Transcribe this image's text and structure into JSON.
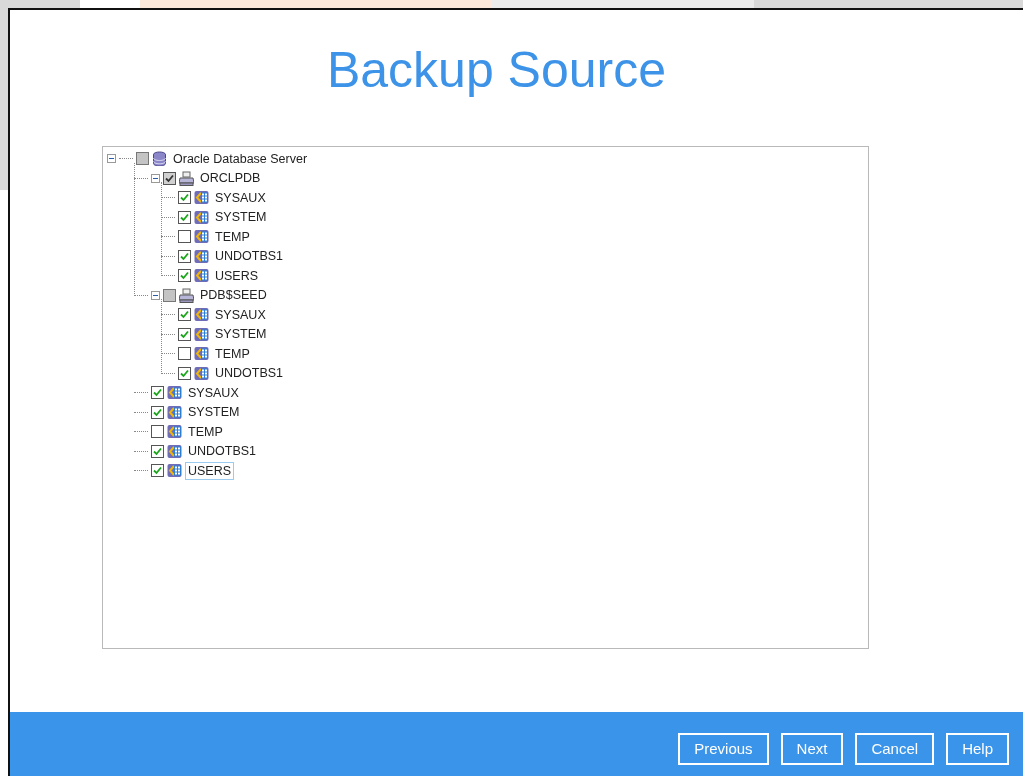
{
  "title": "Backup Source",
  "tree": [
    {
      "label": "Oracle Database Server",
      "kind": "server",
      "checked": false,
      "partial": true,
      "expanded": true,
      "selected": false,
      "children": [
        {
          "label": "ORCLPDB",
          "kind": "database",
          "checked": true,
          "partial": true,
          "expanded": true,
          "selected": false,
          "children": [
            {
              "label": "SYSAUX",
              "kind": "tablespace",
              "checked": true,
              "partial": false,
              "selected": false
            },
            {
              "label": "SYSTEM",
              "kind": "tablespace",
              "checked": true,
              "partial": false,
              "selected": false
            },
            {
              "label": "TEMP",
              "kind": "tablespace",
              "checked": false,
              "partial": false,
              "selected": false
            },
            {
              "label": "UNDOTBS1",
              "kind": "tablespace",
              "checked": true,
              "partial": false,
              "selected": false
            },
            {
              "label": "USERS",
              "kind": "tablespace",
              "checked": true,
              "partial": false,
              "selected": false
            }
          ]
        },
        {
          "label": "PDB$SEED",
          "kind": "database",
          "checked": false,
          "partial": true,
          "expanded": true,
          "selected": false,
          "children": [
            {
              "label": "SYSAUX",
              "kind": "tablespace",
              "checked": true,
              "partial": false,
              "selected": false
            },
            {
              "label": "SYSTEM",
              "kind": "tablespace",
              "checked": true,
              "partial": false,
              "selected": false
            },
            {
              "label": "TEMP",
              "kind": "tablespace",
              "checked": false,
              "partial": false,
              "selected": false
            },
            {
              "label": "UNDOTBS1",
              "kind": "tablespace",
              "checked": true,
              "partial": false,
              "selected": false
            }
          ]
        },
        {
          "label": "SYSAUX",
          "kind": "tablespace",
          "checked": true,
          "partial": false,
          "selected": false
        },
        {
          "label": "SYSTEM",
          "kind": "tablespace",
          "checked": true,
          "partial": false,
          "selected": false
        },
        {
          "label": "TEMP",
          "kind": "tablespace",
          "checked": false,
          "partial": false,
          "selected": false
        },
        {
          "label": "UNDOTBS1",
          "kind": "tablespace",
          "checked": true,
          "partial": false,
          "selected": false
        },
        {
          "label": "USERS",
          "kind": "tablespace",
          "checked": true,
          "partial": false,
          "selected": true
        }
      ]
    }
  ],
  "buttons": [
    "Previous",
    "Next",
    "Cancel",
    "Help"
  ]
}
